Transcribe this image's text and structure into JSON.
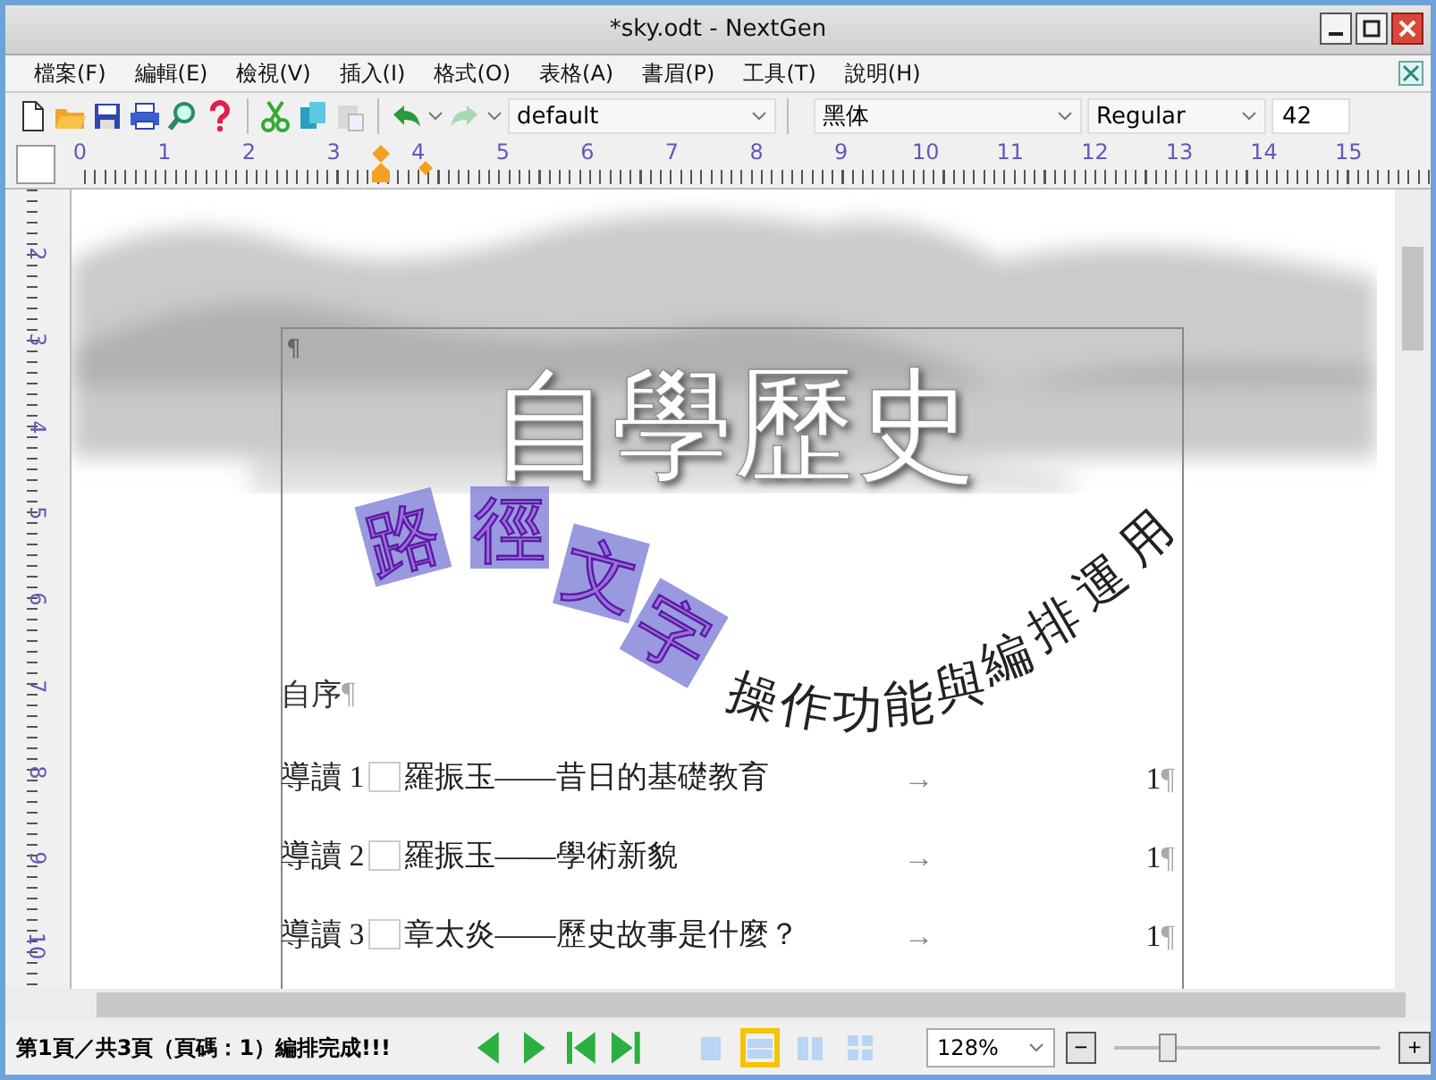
{
  "window": {
    "title": "*sky.odt - NextGen"
  },
  "menu": [
    "檔案(F)",
    "編輯(E)",
    "檢視(V)",
    "插入(I)",
    "格式(O)",
    "表格(A)",
    "書眉(P)",
    "工具(T)",
    "說明(H)"
  ],
  "toolbar": {
    "style": "default",
    "font": "黑体",
    "weight": "Regular",
    "size": "42"
  },
  "ruler": {
    "numbers": [
      "0",
      "1",
      "2",
      "3",
      "4",
      "5",
      "6",
      "7",
      "8",
      "9",
      "10",
      "11",
      "12",
      "13",
      "14",
      "15"
    ],
    "vertical_numbers": [
      "2",
      "3",
      "4",
      "5",
      "6",
      "7",
      "8",
      "9",
      "10"
    ]
  },
  "document": {
    "top_mark": "¶",
    "art_title": "自學歷史",
    "path_text_1": "路徑文字",
    "path_text_2": "操作功能與編排運用",
    "heading": {
      "text": "自序",
      "mark": "¶"
    },
    "toc": [
      {
        "label": "導讀 1",
        "title": "羅振玉——昔日的基礎教育",
        "arrow": "→",
        "page": "1",
        "mark": "¶"
      },
      {
        "label": "導讀 2",
        "title": "羅振玉——學術新貌",
        "arrow": "→",
        "page": "1",
        "mark": "¶"
      },
      {
        "label": "導讀 3",
        "title": "章太炎——歷史故事是什麼？",
        "arrow": "→",
        "page": "1",
        "mark": "¶"
      }
    ]
  },
  "status_bar": {
    "text": "第1頁／共3頁（頁碼：1）編排完成!!!",
    "views": [
      {
        "selected": false
      },
      {
        "selected": true
      },
      {
        "selected": false
      },
      {
        "selected": false
      }
    ],
    "zoom": "128%",
    "zoom_level": {
      "level": 0.2
    },
    "minus": "−",
    "plus": "+"
  }
}
